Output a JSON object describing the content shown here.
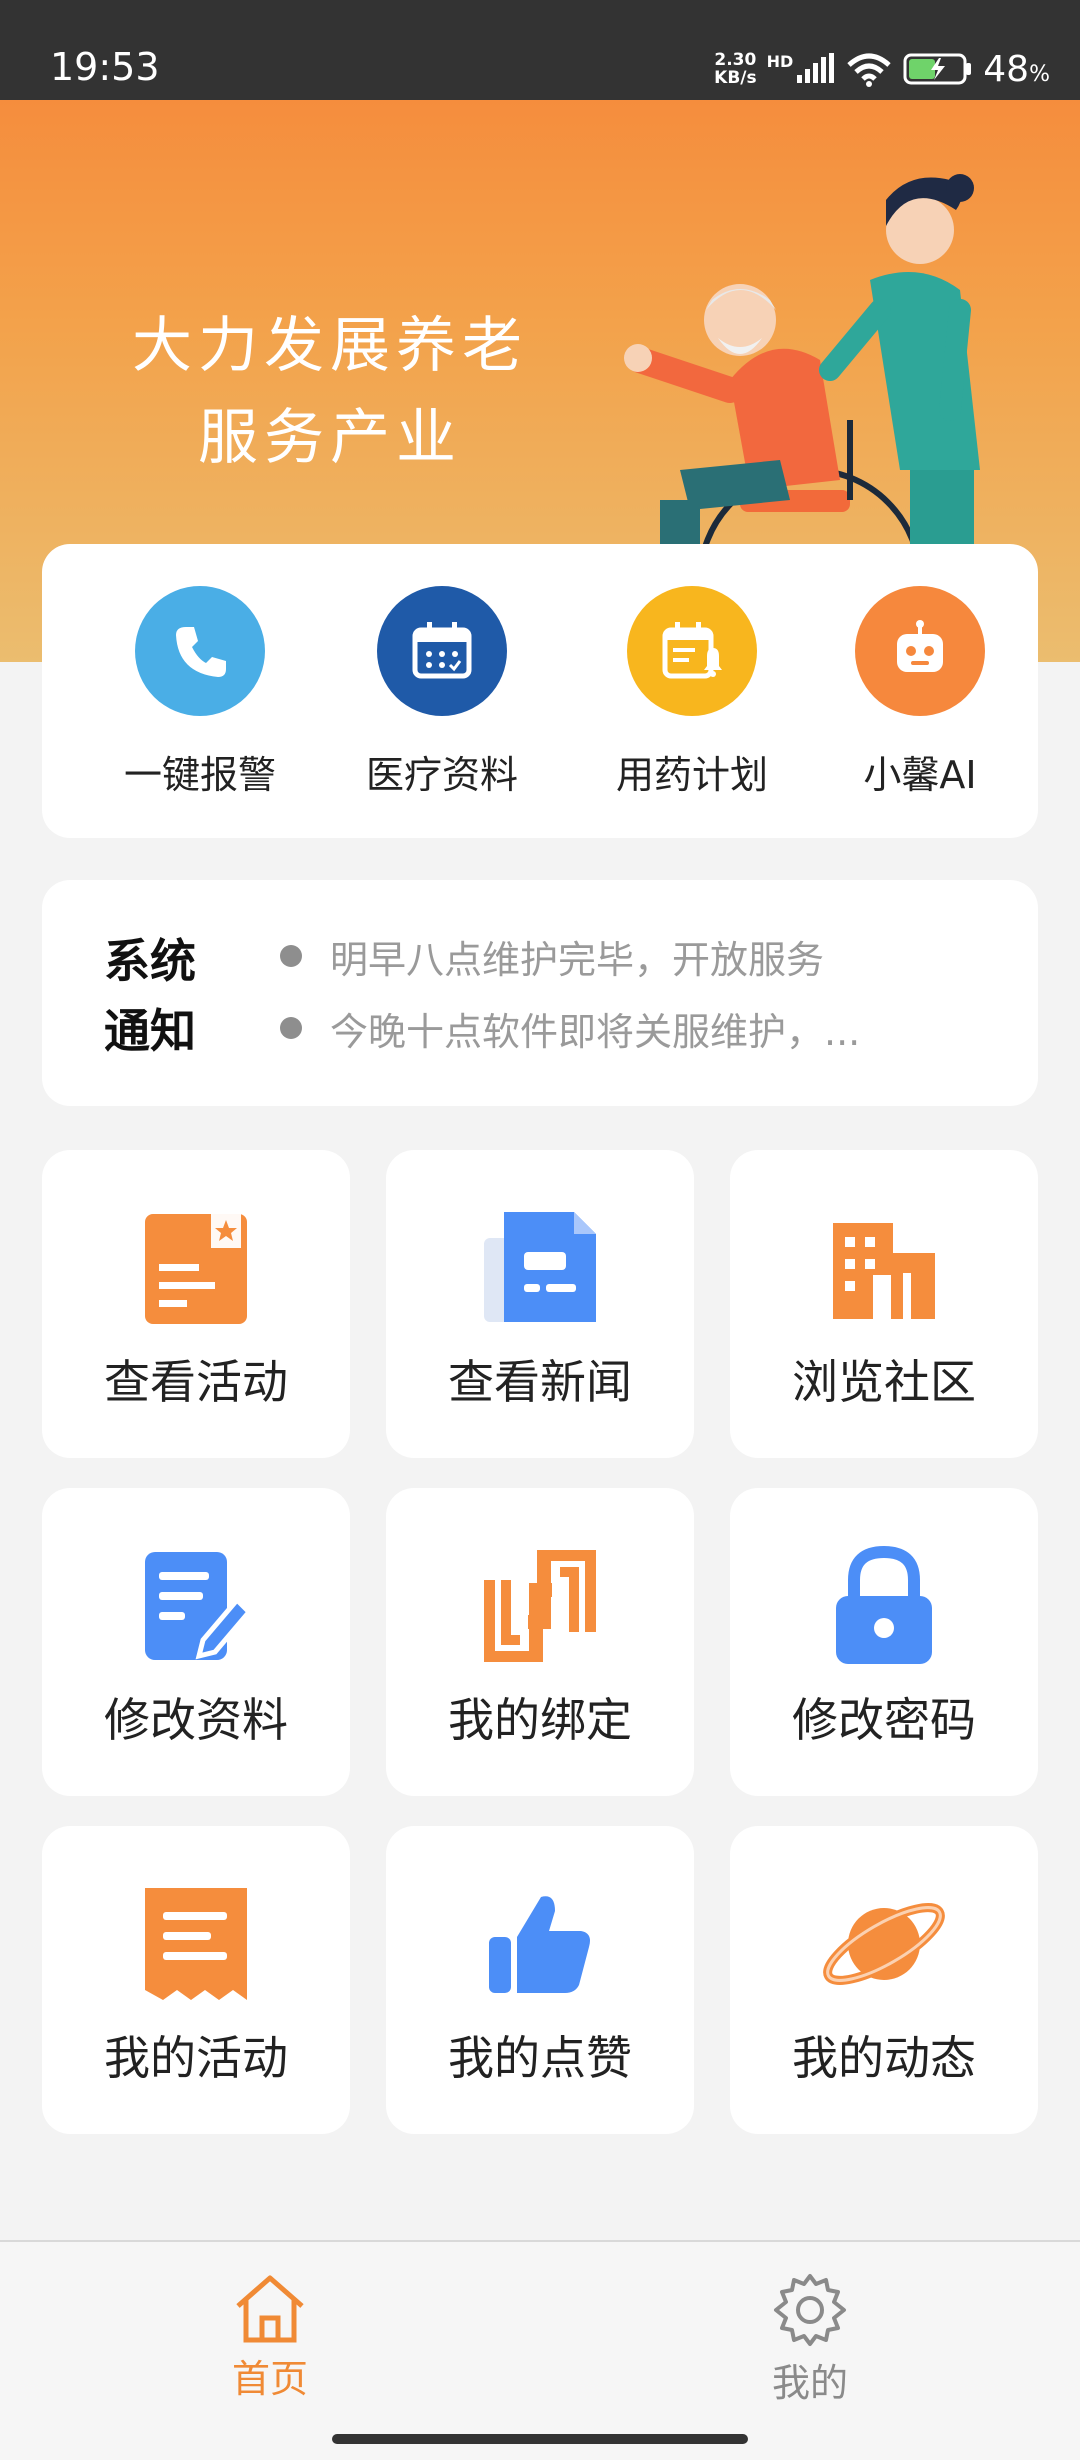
{
  "status_bar": {
    "time": "19:53",
    "net_speed_value": "2.30",
    "net_speed_unit": "KB/s",
    "network_type": "HD",
    "battery_percent": "48",
    "battery_unit": "%"
  },
  "banner": {
    "line1": "大力发展养老",
    "line2": "服务产业"
  },
  "quick_actions": [
    {
      "label": "一键报警",
      "icon": "phone-icon",
      "color": "#4aaee6"
    },
    {
      "label": "医疗资料",
      "icon": "calendar-icon",
      "color": "#1f5aa8"
    },
    {
      "label": "用药计划",
      "icon": "medication-plan-icon",
      "color": "#f8b61e"
    },
    {
      "label": "小馨AI",
      "icon": "robot-icon",
      "color": "#f6883d"
    }
  ],
  "notice": {
    "title": "系统通知",
    "items": [
      "明早八点维护完毕，开放服务",
      "今晚十点软件即将关服维护，..."
    ]
  },
  "grid": [
    {
      "label": "查看活动",
      "icon": "activity-card-icon"
    },
    {
      "label": "查看新闻",
      "icon": "news-icon"
    },
    {
      "label": "浏览社区",
      "icon": "building-icon"
    },
    {
      "label": "修改资料",
      "icon": "edit-document-icon"
    },
    {
      "label": "我的绑定",
      "icon": "binding-icon"
    },
    {
      "label": "修改密码",
      "icon": "lock-icon"
    },
    {
      "label": "我的活动",
      "icon": "receipt-icon"
    },
    {
      "label": "我的点赞",
      "icon": "thumbs-up-icon"
    },
    {
      "label": "我的动态",
      "icon": "planet-icon"
    }
  ],
  "bottom_nav": {
    "home": "首页",
    "mine": "我的"
  },
  "colors": {
    "orange": "#f58d3d",
    "blue": "#4c8ef7",
    "nav_active": "#f08a35",
    "nav_inactive": "#8a8a8a"
  }
}
